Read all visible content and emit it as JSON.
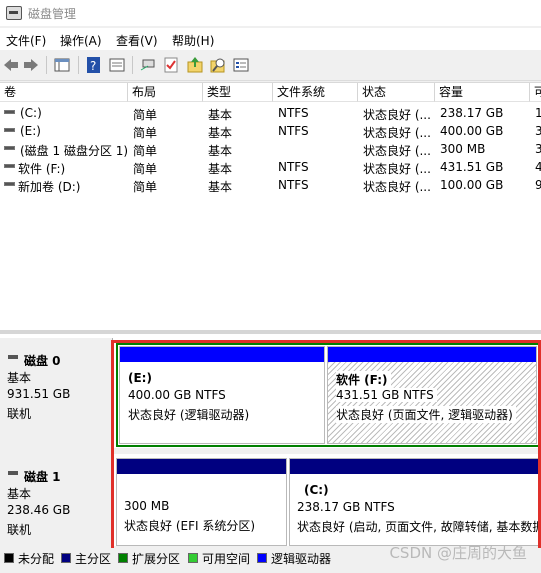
{
  "window": {
    "title": "磁盘管理"
  },
  "menu": {
    "file": "文件(F)",
    "action": "操作(A)",
    "view": "查看(V)",
    "help": "帮助(H)"
  },
  "toolbar": {
    "icons": [
      "back-icon",
      "forward-icon",
      "console-tree-icon",
      "help-icon",
      "properties-icon",
      "connect-icon",
      "check-icon",
      "import-icon",
      "search-icon",
      "settings-list-icon"
    ]
  },
  "volume_list": {
    "headers": {
      "volume": "卷",
      "layout": "布局",
      "type": "类型",
      "filesystem": "文件系统",
      "status": "状态",
      "capacity": "容量",
      "extra": "可"
    },
    "rows": [
      {
        "volume": "(C:)",
        "layout": "简单",
        "type": "基本",
        "filesystem": "NTFS",
        "status": "状态良好 (...",
        "capacity": "238.17 GB",
        "extra": "1"
      },
      {
        "volume": "(E:)",
        "layout": "简单",
        "type": "基本",
        "filesystem": "NTFS",
        "status": "状态良好 (...",
        "capacity": "400.00 GB",
        "extra": "3"
      },
      {
        "volume": "(磁盘 1 磁盘分区 1)",
        "layout": "简单",
        "type": "基本",
        "filesystem": "",
        "status": "状态良好 (...",
        "capacity": "300 MB",
        "extra": "3"
      },
      {
        "volume": "软件 (F:)",
        "layout": "简单",
        "type": "基本",
        "filesystem": "NTFS",
        "status": "状态良好 (...",
        "capacity": "431.51 GB",
        "extra": "4"
      },
      {
        "volume": "新加卷 (D:)",
        "layout": "简单",
        "type": "基本",
        "filesystem": "NTFS",
        "status": "状态良好 (...",
        "capacity": "100.00 GB",
        "extra": "9"
      }
    ]
  },
  "disks": [
    {
      "name": "磁盘 0",
      "kind": "基本",
      "size": "931.51 GB",
      "state": "联机",
      "partitions": [
        {
          "title": "(E:)",
          "size_fs": "400.00 GB NTFS",
          "status": "状态良好 (逻辑驱动器)"
        },
        {
          "title": "软件  (F:)",
          "size_fs": "431.51 GB NTFS",
          "status": "状态良好 (页面文件, 逻辑驱动器)"
        }
      ]
    },
    {
      "name": "磁盘 1",
      "kind": "基本",
      "size": "238.46 GB",
      "state": "联机",
      "partitions": [
        {
          "title": "",
          "size_fs": "300 MB",
          "status": "状态良好 (EFI 系统分区)"
        },
        {
          "title": "(C:)",
          "size_fs": "238.17 GB NTFS",
          "status": "状态良好 (启动, 页面文件, 故障转储, 基本数据"
        }
      ]
    }
  ],
  "legend": [
    {
      "label": "未分配",
      "color": "#000000"
    },
    {
      "label": "主分区",
      "color": "#000080"
    },
    {
      "label": "扩展分区",
      "color": "#008000"
    },
    {
      "label": "可用空间",
      "color": "#33cc33"
    },
    {
      "label": "逻辑驱动器",
      "color": "#0000ff"
    }
  ],
  "watermark": "CSDN @庄周的大鱼",
  "colors": {
    "primary": "#000080",
    "logical": "#0000ff",
    "extended": "#008000",
    "highlight": "#e0302a"
  }
}
